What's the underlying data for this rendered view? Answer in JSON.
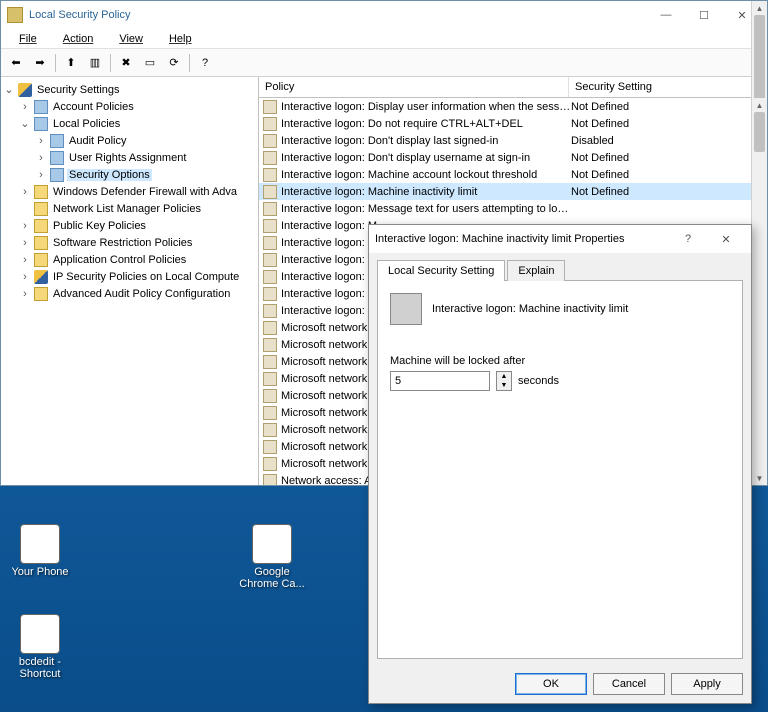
{
  "window": {
    "title": "Local Security Policy",
    "menu": {
      "file": "File",
      "action": "Action",
      "view": "View",
      "help": "Help"
    },
    "sysbuttons": {
      "min": "—",
      "max": "☐",
      "close": "✕"
    }
  },
  "tree": {
    "root": "Security Settings",
    "items": [
      {
        "label": "Account Policies",
        "icon": "fold-b",
        "indent": 1,
        "tw": "›"
      },
      {
        "label": "Local Policies",
        "icon": "fold-b",
        "indent": 1,
        "tw": "⌄",
        "open": true
      },
      {
        "label": "Audit Policy",
        "icon": "fold-b",
        "indent": 2,
        "tw": "›"
      },
      {
        "label": "User Rights Assignment",
        "icon": "fold-b",
        "indent": 2,
        "tw": "›"
      },
      {
        "label": "Security Options",
        "icon": "fold-b",
        "indent": 2,
        "tw": "›",
        "selected": true
      },
      {
        "label": "Windows Defender Firewall with Adva",
        "icon": "fold-y",
        "indent": 1,
        "tw": "›"
      },
      {
        "label": "Network List Manager Policies",
        "icon": "fold-y",
        "indent": 1,
        "tw": ""
      },
      {
        "label": "Public Key Policies",
        "icon": "fold-y",
        "indent": 1,
        "tw": "›"
      },
      {
        "label": "Software Restriction Policies",
        "icon": "fold-y",
        "indent": 1,
        "tw": "›"
      },
      {
        "label": "Application Control Policies",
        "icon": "fold-y",
        "indent": 1,
        "tw": "›"
      },
      {
        "label": "IP Security Policies on Local Compute",
        "icon": "shield",
        "indent": 1,
        "tw": "›"
      },
      {
        "label": "Advanced Audit Policy Configuration",
        "icon": "fold-y",
        "indent": 1,
        "tw": "›"
      }
    ]
  },
  "columns": {
    "policy": "Policy",
    "setting": "Security Setting"
  },
  "rows": [
    {
      "p": "Interactive logon: Display user information when the session...",
      "s": "Not Defined"
    },
    {
      "p": "Interactive logon: Do not require CTRL+ALT+DEL",
      "s": "Not Defined"
    },
    {
      "p": "Interactive logon: Don't display last signed-in",
      "s": "Disabled"
    },
    {
      "p": "Interactive logon: Don't display username at sign-in",
      "s": "Not Defined"
    },
    {
      "p": "Interactive logon: Machine account lockout threshold",
      "s": "Not Defined"
    },
    {
      "p": "Interactive logon: Machine inactivity limit",
      "s": "Not Defined",
      "sel": true
    },
    {
      "p": "Interactive logon: Message text for users attempting to log on",
      "s": ""
    },
    {
      "p": "Interactive logon: M",
      "s": ""
    },
    {
      "p": "Interactive logon: Nu",
      "s": ""
    },
    {
      "p": "Interactive logon: Pr",
      "s": ""
    },
    {
      "p": "Interactive logon: Re",
      "s": ""
    },
    {
      "p": "Interactive logon: Re",
      "s": ""
    },
    {
      "p": "Interactive logon: Sm",
      "s": ""
    },
    {
      "p": "Microsoft network cl",
      "s": ""
    },
    {
      "p": "Microsoft network cl",
      "s": ""
    },
    {
      "p": "Microsoft network cl",
      "s": ""
    },
    {
      "p": "Microsoft network se",
      "s": ""
    },
    {
      "p": "Microsoft network se",
      "s": ""
    },
    {
      "p": "Microsoft network se",
      "s": ""
    },
    {
      "p": "Microsoft network se",
      "s": ""
    },
    {
      "p": "Microsoft network se",
      "s": ""
    },
    {
      "p": "Microsoft network se",
      "s": ""
    },
    {
      "p": "Network access: Allo",
      "s": ""
    }
  ],
  "dialog": {
    "title": "Interactive logon: Machine inactivity limit Properties",
    "tabs": {
      "local": "Local Security Setting",
      "explain": "Explain"
    },
    "policy_name": "Interactive logon: Machine inactivity limit",
    "field_label": "Machine will be locked after",
    "value": "5",
    "unit": "seconds",
    "buttons": {
      "ok": "OK",
      "cancel": "Cancel",
      "apply": "Apply"
    },
    "help": "?",
    "close": "✕"
  },
  "desktop": {
    "your_phone": "Your Phone",
    "chrome": "Google Chrome Ca...",
    "bcdedit": "bcdedit - Shortcut"
  },
  "toolbar_glyphs": {
    "back": "⬅",
    "fwd": "➡",
    "up": "⬆",
    "props": "▥",
    "del": "✖",
    "export": "▭",
    "refresh": "⟳",
    "help": "?"
  }
}
